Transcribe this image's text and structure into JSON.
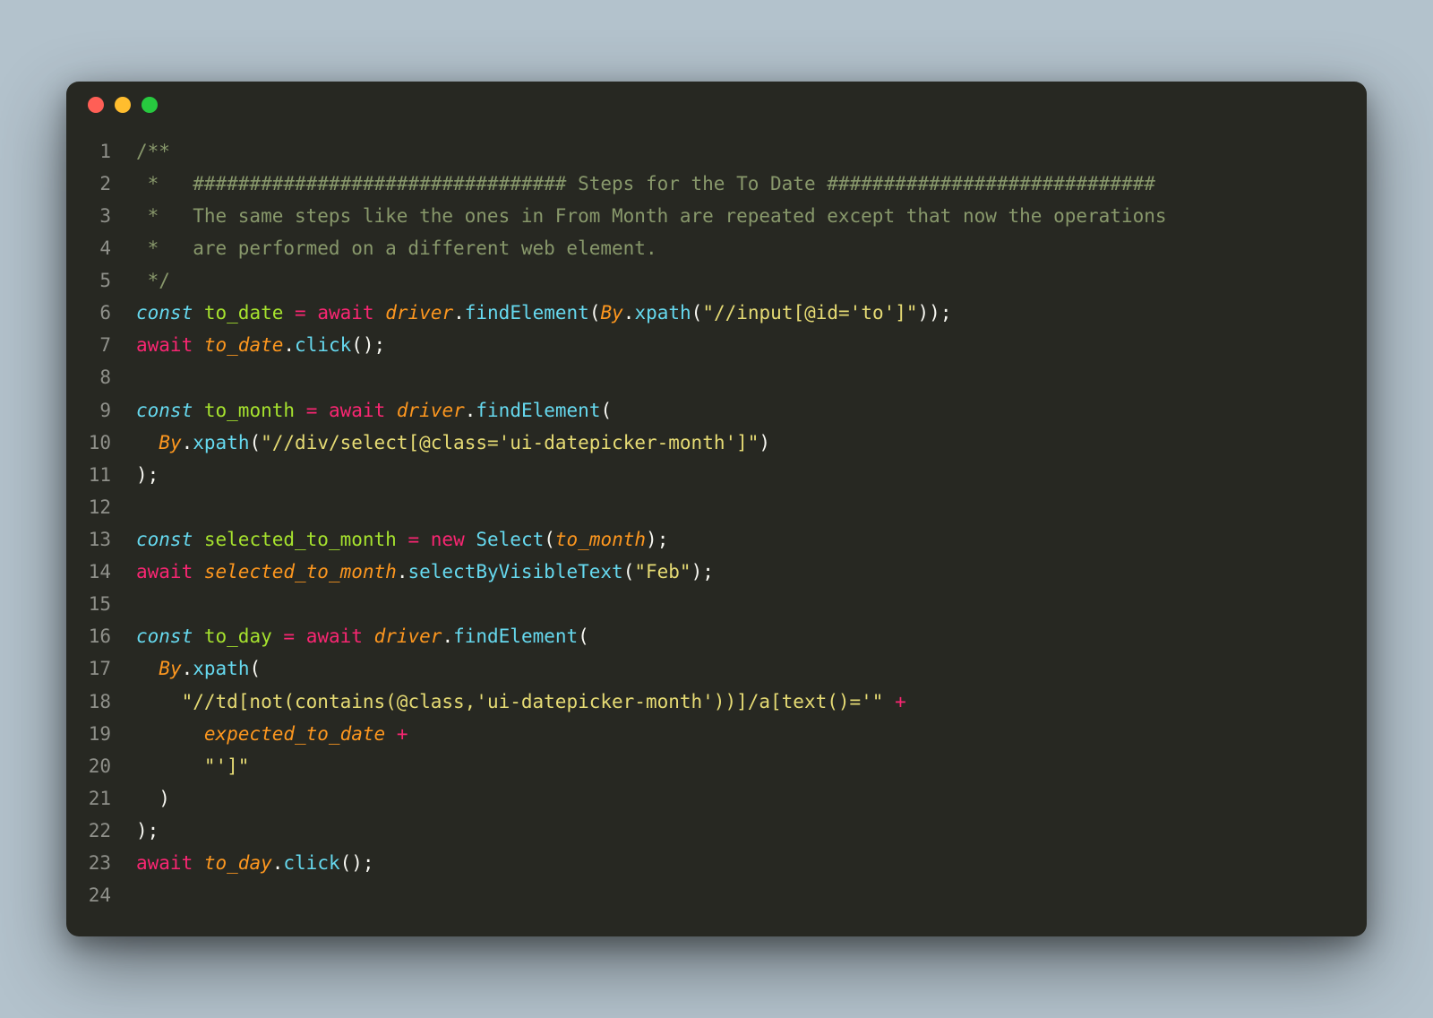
{
  "window": {
    "traffic_lights": [
      "close",
      "minimize",
      "zoom"
    ]
  },
  "code": {
    "lines": [
      {
        "n": 1,
        "tokens": [
          [
            "comment",
            "/**"
          ]
        ]
      },
      {
        "n": 2,
        "tokens": [
          [
            "comment",
            " *   ################################# Steps for the To Date #############################"
          ]
        ]
      },
      {
        "n": 3,
        "tokens": [
          [
            "comment",
            " *   The same steps like the ones in From Month are repeated except that now the operations"
          ]
        ]
      },
      {
        "n": 4,
        "tokens": [
          [
            "comment",
            " *   are performed on a different web element."
          ]
        ]
      },
      {
        "n": 5,
        "tokens": [
          [
            "comment",
            " */"
          ]
        ]
      },
      {
        "n": 6,
        "tokens": [
          [
            "def",
            "const"
          ],
          [
            "plain",
            " "
          ],
          [
            "var",
            "to_date"
          ],
          [
            "plain",
            " "
          ],
          [
            "op",
            "="
          ],
          [
            "plain",
            " "
          ],
          [
            "keyword",
            "await"
          ],
          [
            "plain",
            " "
          ],
          [
            "ident",
            "driver"
          ],
          [
            "plain",
            "."
          ],
          [
            "func",
            "findElement"
          ],
          [
            "paren",
            "("
          ],
          [
            "ident",
            "By"
          ],
          [
            "plain",
            "."
          ],
          [
            "func",
            "xpath"
          ],
          [
            "paren",
            "("
          ],
          [
            "string",
            "\"//input[@id='to']\""
          ],
          [
            "paren",
            "));"
          ]
        ]
      },
      {
        "n": 7,
        "tokens": [
          [
            "keyword",
            "await"
          ],
          [
            "plain",
            " "
          ],
          [
            "ident",
            "to_date"
          ],
          [
            "plain",
            "."
          ],
          [
            "func",
            "click"
          ],
          [
            "paren",
            "();"
          ]
        ]
      },
      {
        "n": 8,
        "tokens": [
          [
            "plain",
            ""
          ]
        ]
      },
      {
        "n": 9,
        "tokens": [
          [
            "def",
            "const"
          ],
          [
            "plain",
            " "
          ],
          [
            "var",
            "to_month"
          ],
          [
            "plain",
            " "
          ],
          [
            "op",
            "="
          ],
          [
            "plain",
            " "
          ],
          [
            "keyword",
            "await"
          ],
          [
            "plain",
            " "
          ],
          [
            "ident",
            "driver"
          ],
          [
            "plain",
            "."
          ],
          [
            "func",
            "findElement"
          ],
          [
            "paren",
            "("
          ]
        ]
      },
      {
        "n": 10,
        "tokens": [
          [
            "plain",
            "  "
          ],
          [
            "ident",
            "By"
          ],
          [
            "plain",
            "."
          ],
          [
            "func",
            "xpath"
          ],
          [
            "paren",
            "("
          ],
          [
            "string",
            "\"//div/select[@class='ui-datepicker-month']\""
          ],
          [
            "paren",
            ")"
          ]
        ]
      },
      {
        "n": 11,
        "tokens": [
          [
            "paren",
            ");"
          ]
        ]
      },
      {
        "n": 12,
        "tokens": [
          [
            "plain",
            ""
          ]
        ]
      },
      {
        "n": 13,
        "tokens": [
          [
            "def",
            "const"
          ],
          [
            "plain",
            " "
          ],
          [
            "var",
            "selected_to_month"
          ],
          [
            "plain",
            " "
          ],
          [
            "op",
            "="
          ],
          [
            "plain",
            " "
          ],
          [
            "keyword",
            "new"
          ],
          [
            "plain",
            " "
          ],
          [
            "func",
            "Select"
          ],
          [
            "paren",
            "("
          ],
          [
            "ident",
            "to_month"
          ],
          [
            "paren",
            ");"
          ]
        ]
      },
      {
        "n": 14,
        "tokens": [
          [
            "keyword",
            "await"
          ],
          [
            "plain",
            " "
          ],
          [
            "ident",
            "selected_to_month"
          ],
          [
            "plain",
            "."
          ],
          [
            "func",
            "selectByVisibleText"
          ],
          [
            "paren",
            "("
          ],
          [
            "string",
            "\"Feb\""
          ],
          [
            "paren",
            ");"
          ]
        ]
      },
      {
        "n": 15,
        "tokens": [
          [
            "plain",
            ""
          ]
        ]
      },
      {
        "n": 16,
        "tokens": [
          [
            "def",
            "const"
          ],
          [
            "plain",
            " "
          ],
          [
            "var",
            "to_day"
          ],
          [
            "plain",
            " "
          ],
          [
            "op",
            "="
          ],
          [
            "plain",
            " "
          ],
          [
            "keyword",
            "await"
          ],
          [
            "plain",
            " "
          ],
          [
            "ident",
            "driver"
          ],
          [
            "plain",
            "."
          ],
          [
            "func",
            "findElement"
          ],
          [
            "paren",
            "("
          ]
        ]
      },
      {
        "n": 17,
        "tokens": [
          [
            "plain",
            "  "
          ],
          [
            "ident",
            "By"
          ],
          [
            "plain",
            "."
          ],
          [
            "func",
            "xpath"
          ],
          [
            "paren",
            "("
          ]
        ]
      },
      {
        "n": 18,
        "tokens": [
          [
            "plain",
            "    "
          ],
          [
            "string",
            "\"//td[not(contains(@class,'ui-datepicker-month'))]/a[text()='\""
          ],
          [
            "plain",
            " "
          ],
          [
            "op",
            "+"
          ]
        ]
      },
      {
        "n": 19,
        "tokens": [
          [
            "plain",
            "      "
          ],
          [
            "ident",
            "expected_to_date"
          ],
          [
            "plain",
            " "
          ],
          [
            "op",
            "+"
          ]
        ]
      },
      {
        "n": 20,
        "tokens": [
          [
            "plain",
            "      "
          ],
          [
            "string",
            "\"']\""
          ]
        ]
      },
      {
        "n": 21,
        "tokens": [
          [
            "plain",
            "  "
          ],
          [
            "paren",
            ")"
          ]
        ]
      },
      {
        "n": 22,
        "tokens": [
          [
            "paren",
            ");"
          ]
        ]
      },
      {
        "n": 23,
        "tokens": [
          [
            "keyword",
            "await"
          ],
          [
            "plain",
            " "
          ],
          [
            "ident",
            "to_day"
          ],
          [
            "plain",
            "."
          ],
          [
            "func",
            "click"
          ],
          [
            "paren",
            "();"
          ]
        ]
      },
      {
        "n": 24,
        "tokens": [
          [
            "plain",
            ""
          ]
        ]
      }
    ]
  }
}
